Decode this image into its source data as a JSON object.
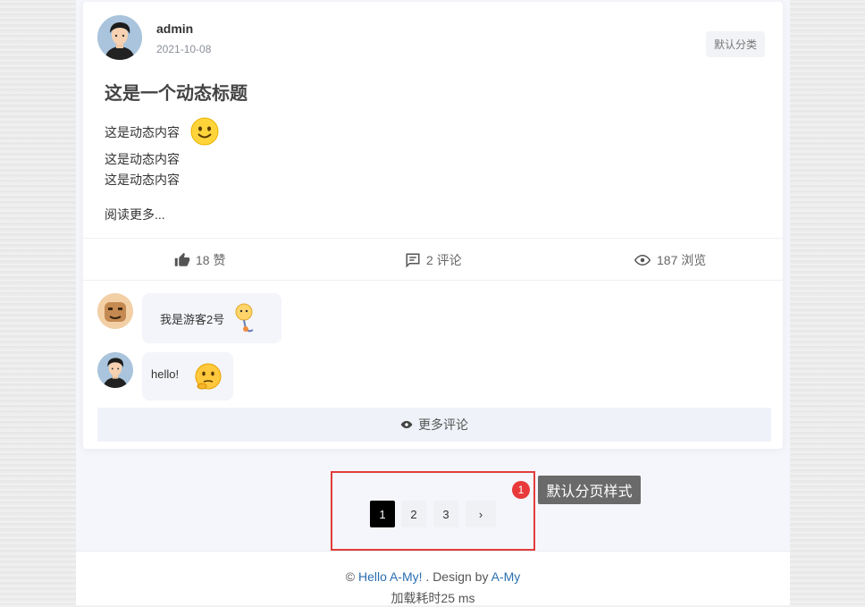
{
  "post": {
    "author": "admin",
    "date": "2021-10-08",
    "category": "默认分类",
    "title": "这是一个动态标题",
    "content_lines": [
      "这是动态内容",
      "这是动态内容",
      "这是动态内容"
    ],
    "read_more": "阅读更多..."
  },
  "stats": {
    "likes_label": "18 赞",
    "comments_label": "2 评论",
    "views_label": "187 浏览"
  },
  "comments": [
    {
      "text": "我是游客2号"
    },
    {
      "text": "hello!"
    }
  ],
  "more_comments_label": "更多评论",
  "pagination": {
    "pages": [
      "1",
      "2",
      "3"
    ],
    "current": "1",
    "next_label": "›"
  },
  "annotation": {
    "number": "1",
    "label": "默认分页样式"
  },
  "footer": {
    "copyright_symbol": "©",
    "site_link": "Hello A-My!",
    "design_prefix": ". Design by",
    "designer_link": "A-My",
    "load_time": "加载耗时25 ms"
  },
  "colors": {
    "link": "#2a6fb0",
    "annotation_red": "#e23c3c",
    "active_page": "#000000"
  }
}
